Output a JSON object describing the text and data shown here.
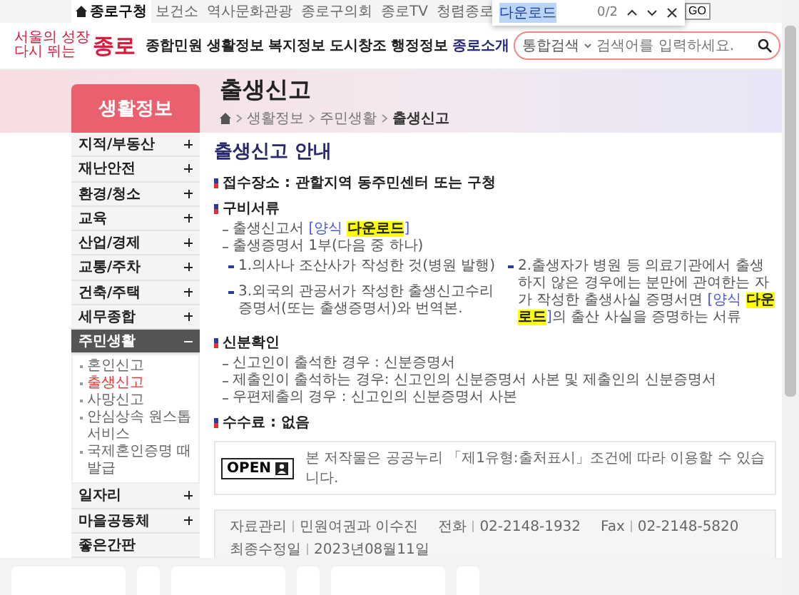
{
  "find_bar": {
    "query": "다운로드",
    "count": "0/2"
  },
  "top_links": [
    {
      "label": "종로구청",
      "selected": true
    },
    {
      "label": "보건소",
      "selected": false
    },
    {
      "label": "역사문화관광",
      "selected": false
    },
    {
      "label": "종로구의회",
      "selected": false
    },
    {
      "label": "종로TV",
      "selected": false
    },
    {
      "label": "청렴종로",
      "selected": false
    }
  ],
  "go_label": "GO",
  "logo": {
    "line1": "서울의 성장",
    "line2": "다시 뛰는",
    "name": "종로"
  },
  "nav": [
    {
      "label": "종합민원",
      "selected": false
    },
    {
      "label": "생활정보",
      "selected": false
    },
    {
      "label": "복지정보",
      "selected": false
    },
    {
      "label": "도시창조",
      "selected": false
    },
    {
      "label": "행정정보",
      "selected": false
    },
    {
      "label": "종로소개",
      "selected": true
    }
  ],
  "search": {
    "scope": "통합검색",
    "placeholder": "검색어를 입력하세요."
  },
  "banner": {
    "section": "생활정보",
    "title": "출생신고",
    "breadcrumb": [
      "생활정보",
      "주민생활",
      "출생신고"
    ]
  },
  "sidebar": [
    {
      "label": "지적/부동산",
      "expanded": false
    },
    {
      "label": "재난안전",
      "expanded": false
    },
    {
      "label": "환경/청소",
      "expanded": false
    },
    {
      "label": "교육",
      "expanded": false
    },
    {
      "label": "산업/경제",
      "expanded": false
    },
    {
      "label": "교통/주차",
      "expanded": false
    },
    {
      "label": "건축/주택",
      "expanded": false
    },
    {
      "label": "세무종합",
      "expanded": false
    },
    {
      "label": "주민생활",
      "expanded": true,
      "children": [
        {
          "label": "혼인신고",
          "selected": false
        },
        {
          "label": "출생신고",
          "selected": true
        },
        {
          "label": "사망신고",
          "selected": false
        },
        {
          "label": "안심상속 원스톱서비스",
          "selected": false
        },
        {
          "label": "국제혼인증명 때발급",
          "selected": false
        }
      ]
    },
    {
      "label": "일자리",
      "expanded": false
    },
    {
      "label": "마을공동체",
      "expanded": false
    },
    {
      "label": "좋은간판"
    }
  ],
  "content": {
    "heading": "출생신고 안내",
    "blocks": [
      {
        "kind": "title",
        "text": "접수장소 : 관할지역 동주민센터 또는 구청"
      },
      {
        "kind": "title",
        "text": "구비서류"
      },
      {
        "kind": "list",
        "items": [
          [
            {
              "kind": "plain",
              "text": "출생신고서 "
            },
            {
              "kind": "link",
              "text": "[양식 "
            },
            {
              "kind": "match",
              "text": "다운로드"
            },
            {
              "kind": "link",
              "text": "]"
            }
          ],
          [
            {
              "kind": "plain",
              "text": "출생증명서 1부(다음 중 하나)"
            }
          ]
        ]
      },
      {
        "kind": "grid",
        "items": [
          [
            {
              "kind": "plain",
              "text": "1.의사나 조산사가 작성한 것(병원 발행)"
            }
          ],
          [
            {
              "kind": "plain",
              "text": "2.출생자가 병원 등 의료기관에서 출생하지 않은 경우에는 분만에 관여한는 자가 작성한 출생사실 증명서면 "
            },
            {
              "kind": "link",
              "text": "[양식 "
            },
            {
              "kind": "match",
              "text": "다운로드"
            },
            {
              "kind": "link",
              "text": "]"
            },
            {
              "kind": "plain",
              "text": "의 출산 사실을 증명하는 서류"
            }
          ],
          [
            {
              "kind": "plain",
              "text": "3.외국의 관공서가 작성한 출생신고수리증명서(또는 출생증명서)와 번역본."
            }
          ]
        ]
      },
      {
        "kind": "title",
        "text": "신분확인"
      },
      {
        "kind": "list",
        "items": [
          [
            {
              "kind": "plain",
              "text": "신고인이 출석한 경우 : 신분증명서"
            }
          ],
          [
            {
              "kind": "plain",
              "text": "제출인이 출석하는 경우: 신고인의 신분증명서 사본 및 제출인의 신분증명서"
            }
          ],
          [
            {
              "kind": "plain",
              "text": "우편제출의 경우 : 신고인의 신분증명서 사본"
            }
          ]
        ]
      },
      {
        "kind": "title",
        "text": "수수료 : 없음"
      }
    ]
  },
  "license": {
    "badge": "OPEN",
    "note": "본 저작물은 공공누리 「제1유형:출처표시」조건에 따라 이용할 수 있습니다."
  },
  "info": [
    {
      "label": "자료관리",
      "value": "민원여권과 이수진"
    },
    {
      "label": "전화",
      "value": "02-2148-1932"
    },
    {
      "label": "Fax",
      "value": "02-2148-5820"
    },
    {
      "label": "최종수정일",
      "value": "2023년08월11일"
    }
  ]
}
